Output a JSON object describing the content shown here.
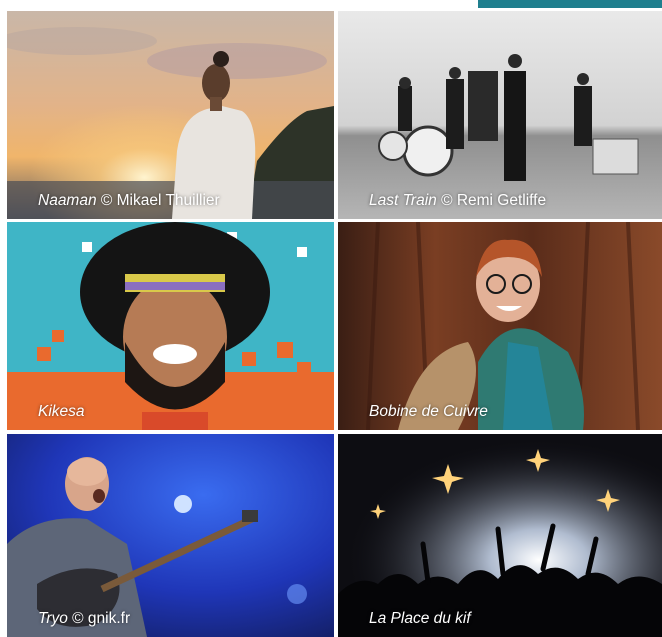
{
  "tiles": [
    {
      "name": "Naaman",
      "credit": " © Mikael Thuillier"
    },
    {
      "name": "Last Train",
      "credit": " © Remi Getliffe"
    },
    {
      "name": "Kikesa",
      "credit": ""
    },
    {
      "name": "Bobine de Cuivre",
      "credit": ""
    },
    {
      "name": "Tryo",
      "credit": " © gnik.fr"
    },
    {
      "name": "La Place du kif",
      "credit": ""
    }
  ],
  "colors": {
    "accent": "#1f7f8e"
  }
}
